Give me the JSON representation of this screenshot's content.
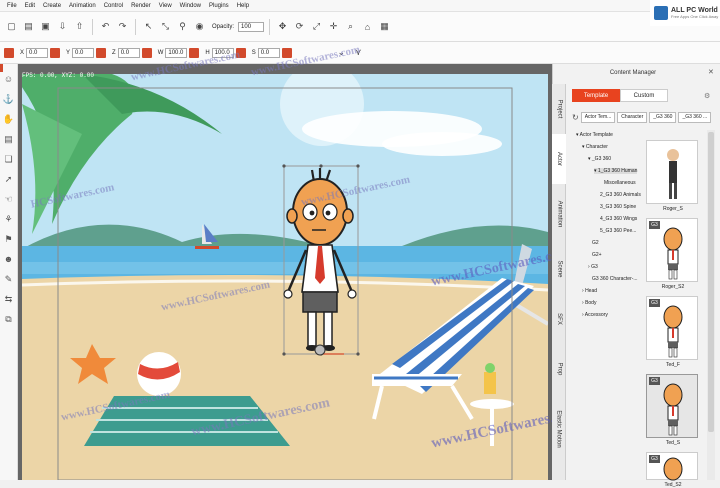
{
  "menu": [
    "File",
    "Edit",
    "Create",
    "Animation",
    "Control",
    "Render",
    "View",
    "Window",
    "Plugins",
    "Help"
  ],
  "toolbar": {
    "opacity_label": "Opacity:",
    "opacity_value": "100"
  },
  "transform": {
    "x_label": "X",
    "x_value": "0.0",
    "y_label": "Y",
    "y_value": "0.0",
    "z_label": "Z",
    "z_value": "0.0",
    "w_label": "W",
    "w_value": "100.0",
    "h_label": "H",
    "h_value": "100.0",
    "s_label": "S",
    "s_value": "0.0"
  },
  "canvas": {
    "fps_text": "FPS: 0.00, XYZ: 0.00"
  },
  "content_manager": {
    "title": "Content Manager",
    "tabs": [
      "Template",
      "Custom"
    ],
    "active_tab": "Template",
    "breadcrumbs": [
      "Actor Tem...",
      "Character",
      "_G3 360",
      "_G3 360 ..."
    ],
    "vertical_tabs": [
      "Project",
      "Actor",
      "Animation",
      "Scene",
      "SFX",
      "Prop",
      "Elastic Motion"
    ],
    "active_vertical_tab": "Actor",
    "tree": [
      {
        "label": "Actor Template",
        "selected": false
      },
      {
        "label": "Character",
        "selected": false
      },
      {
        "label": "_G3 360",
        "selected": false
      },
      {
        "label": "1_G3 360 Human",
        "selected": true
      },
      {
        "label": "Miscellaneous",
        "selected": false
      },
      {
        "label": "2_G3 360 Animals",
        "selected": false
      },
      {
        "label": "3_G3 360 Spine",
        "selected": false
      },
      {
        "label": "4_G3 360 Wings",
        "selected": false
      },
      {
        "label": "5_G3 360 Pee...",
        "selected": false
      },
      {
        "label": "G2",
        "selected": false
      },
      {
        "label": "G2+",
        "selected": false
      },
      {
        "label": "G3",
        "selected": false
      },
      {
        "label": "G3 360 Character-...",
        "selected": false
      },
      {
        "label": "Head",
        "selected": false
      },
      {
        "label": "Body",
        "selected": false
      },
      {
        "label": "Accessory",
        "selected": false
      }
    ],
    "thumbnails": [
      {
        "label": "Roger_S",
        "badge": "",
        "selected": false
      },
      {
        "label": "Roger_S2",
        "badge": "G3",
        "selected": false
      },
      {
        "label": "Ted_F",
        "badge": "G3",
        "selected": false
      },
      {
        "label": "Ted_S",
        "badge": "G3",
        "selected": true
      },
      {
        "label": "Ted_S2",
        "badge": "G3",
        "selected": false
      }
    ]
  },
  "watermark": {
    "brand_title": "ALL PC World",
    "brand_sub": "Free Apps One Click Away",
    "text_site": "www.HCSoftwares.com",
    "text_short": "HCSoftwares.com",
    "text_banner": "www.HCSoftwares.com"
  },
  "colors": {
    "accent": "#e8431f",
    "sky": "#bfe4f4",
    "sea": "#5cb6e3",
    "sand": "#ecd5a7"
  }
}
